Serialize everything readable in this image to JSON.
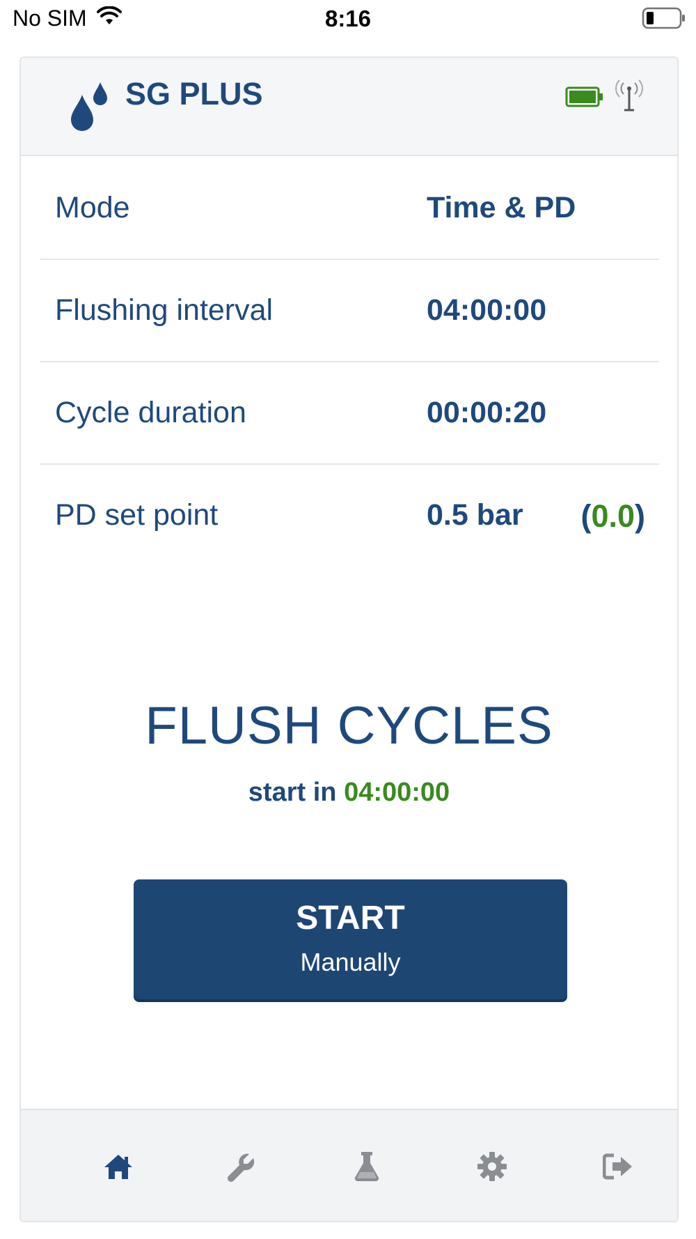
{
  "status_bar": {
    "carrier": "No SIM",
    "time": "8:16"
  },
  "header": {
    "device_name": "SG PLUS",
    "icons": [
      "water-drops-logo-icon",
      "battery-full-icon",
      "antenna-signal-icon"
    ],
    "battery_color": "#3a8a1f"
  },
  "settings": {
    "mode": {
      "label": "Mode",
      "value": "Time & PD"
    },
    "flushing_interval": {
      "label": "Flushing interval",
      "value": "04:00:00"
    },
    "cycle_duration": {
      "label": "Cycle duration",
      "value": "00:00:20"
    },
    "pd_set_point": {
      "label": "PD set point",
      "value": "0.5 bar",
      "current_open": "(",
      "current_value": "0.0",
      "current_close": ")"
    }
  },
  "flush": {
    "title": "FLUSH CYCLES",
    "start_in_label": "start in",
    "start_in_value": "04:00:00"
  },
  "start_button": {
    "main_label": "START",
    "sub_label": "Manually"
  },
  "bottom_nav": {
    "items": [
      {
        "icon": "home-icon",
        "active": true
      },
      {
        "icon": "wrench-icon",
        "active": false
      },
      {
        "icon": "flask-icon",
        "active": false
      },
      {
        "icon": "gear-icon",
        "active": false
      },
      {
        "icon": "logout-icon",
        "active": false
      }
    ]
  },
  "colors": {
    "primary": "#1f497d",
    "button": "#1e4673",
    "accent_green": "#3a8a1f",
    "inactive_icon": "#8a8d91"
  }
}
